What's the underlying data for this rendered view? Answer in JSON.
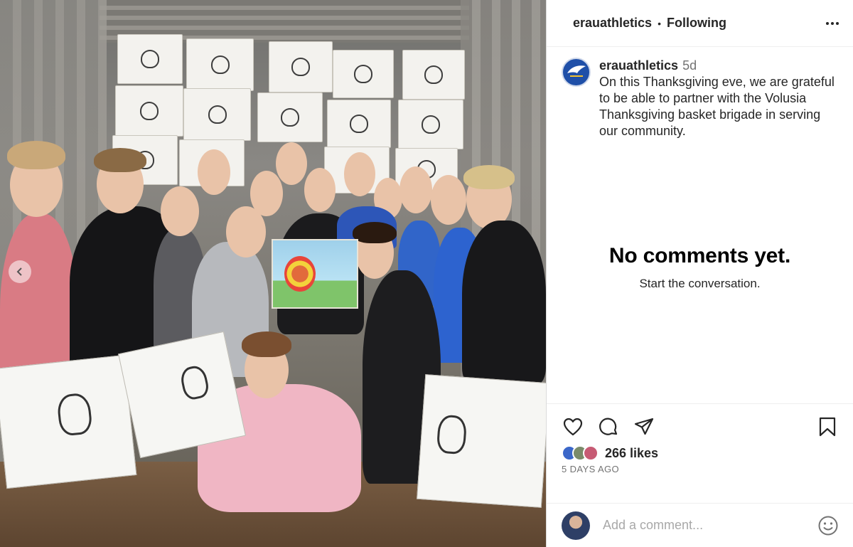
{
  "header": {
    "username": "erauathletics",
    "separator": "•",
    "follow_label": "Following",
    "more_icon": "more-horizontal-icon"
  },
  "caption": {
    "username": "erauathletics",
    "time_ago": "5d",
    "text": "On this Thanksgiving eve, we are grateful to be able to partner with the Volusia Thanksgiving basket brigade in serving our community."
  },
  "comments": {
    "empty_title": "No comments yet.",
    "empty_subtitle": "Start the conversation."
  },
  "actions": {
    "like_icon": "heart-icon",
    "comment_icon": "comment-icon",
    "share_icon": "share-icon",
    "save_icon": "bookmark-icon"
  },
  "likes": {
    "count_label": "266 likes",
    "date_label": "5 DAYS AGO"
  },
  "composer": {
    "placeholder": "Add a comment...",
    "emoji_icon": "emoji-icon"
  },
  "photo": {
    "prev_icon": "chevron-left-icon"
  },
  "colors": {
    "text": "#262626",
    "muted": "#737373",
    "placeholder": "#a8a8a8",
    "divider": "#efefef"
  }
}
